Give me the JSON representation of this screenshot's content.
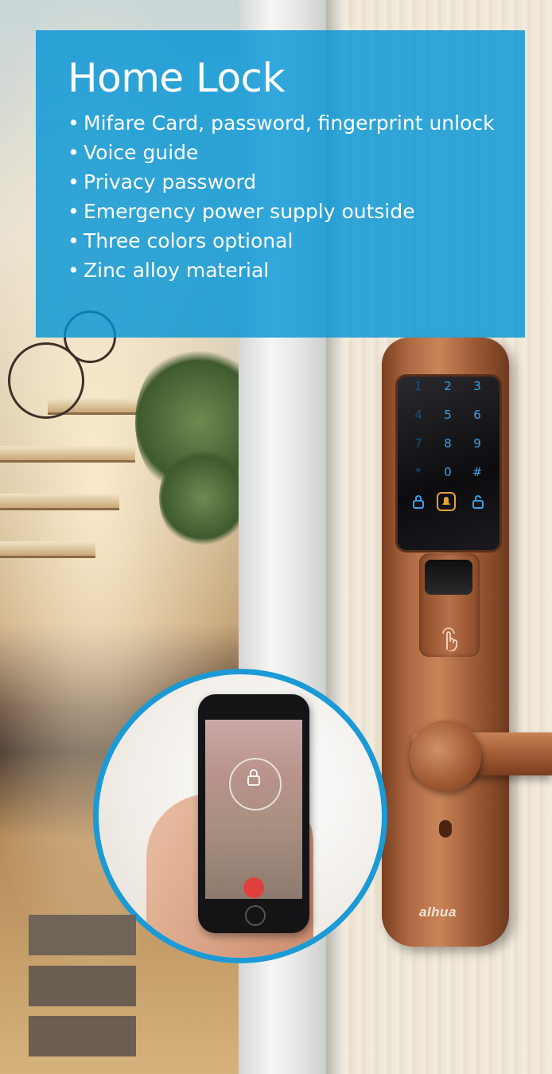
{
  "panel": {
    "title": "Home Lock",
    "bullet_char": "•",
    "features": [
      "Mifare Card, password, fingerprint unlock",
      "Voice guide",
      "Privacy password",
      "Emergency power supply outside",
      "Three colors optional",
      "Zinc alloy material"
    ]
  },
  "colors": {
    "panel_blue": "#0094d6",
    "circle_border": "#1b9ad6",
    "lock_finish": "#a45c36",
    "swatches": [
      "#6f6457",
      "#6a5e50",
      "#6c5f51"
    ]
  },
  "keypad": {
    "keys": [
      "1",
      "2",
      "3",
      "4",
      "5",
      "6",
      "7",
      "8",
      "9",
      "*",
      "0",
      "#"
    ],
    "bottom_icons": [
      "lock-icon",
      "bell-icon",
      "unlock-icon"
    ]
  },
  "brand": {
    "logo_text": "alhua"
  },
  "icons": {
    "fingerprint": "finger-touch-icon",
    "phone_lock": "padlock-icon"
  }
}
